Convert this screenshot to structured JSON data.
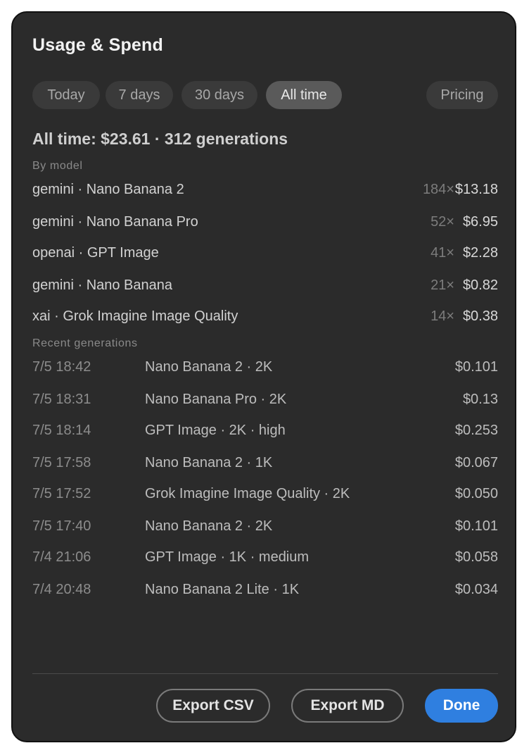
{
  "dialog": {
    "title": "Usage & Spend"
  },
  "tabs": [
    {
      "label": "Today",
      "active": false
    },
    {
      "label": "7 days",
      "active": false
    },
    {
      "label": "30 days",
      "active": false
    },
    {
      "label": "All time",
      "active": true
    }
  ],
  "pricing_label": "Pricing",
  "summary": "All time: $23.61 · 312 generations",
  "by_model": {
    "label": "By model",
    "rows": [
      {
        "name": "gemini · Nano Banana 2",
        "count": "184×",
        "cost": "$13.18"
      },
      {
        "name": "gemini · Nano Banana Pro",
        "count": "52×",
        "cost": "$6.95"
      },
      {
        "name": "openai · GPT Image",
        "count": "41×",
        "cost": "$2.28"
      },
      {
        "name": "gemini · Nano Banana",
        "count": "21×",
        "cost": "$0.82"
      },
      {
        "name": "xai · Grok Imagine Image Quality",
        "count": "14×",
        "cost": "$0.38"
      }
    ]
  },
  "recent": {
    "label": "Recent generations",
    "rows": [
      {
        "time": "7/5 18:42",
        "desc": "Nano Banana 2 · 2K",
        "cost": "$0.101"
      },
      {
        "time": "7/5 18:31",
        "desc": "Nano Banana Pro · 2K",
        "cost": "$0.13"
      },
      {
        "time": "7/5 18:14",
        "desc": "GPT Image · 2K · high",
        "cost": "$0.253"
      },
      {
        "time": "7/5 17:58",
        "desc": "Nano Banana 2 · 1K",
        "cost": "$0.067"
      },
      {
        "time": "7/5 17:52",
        "desc": "Grok Imagine Image Quality · 2K",
        "cost": "$0.050"
      },
      {
        "time": "7/5 17:40",
        "desc": "Nano Banana 2 · 2K",
        "cost": "$0.101"
      },
      {
        "time": "7/4 21:06",
        "desc": "GPT Image · 1K · medium",
        "cost": "$0.058"
      },
      {
        "time": "7/4 20:48",
        "desc": "Nano Banana 2 Lite · 1K",
        "cost": "$0.034"
      }
    ]
  },
  "footer": {
    "export_csv": "Export CSV",
    "export_md": "Export MD",
    "done": "Done"
  },
  "colors": {
    "background": "#2b2b2b",
    "accent": "#2f7fe0"
  }
}
